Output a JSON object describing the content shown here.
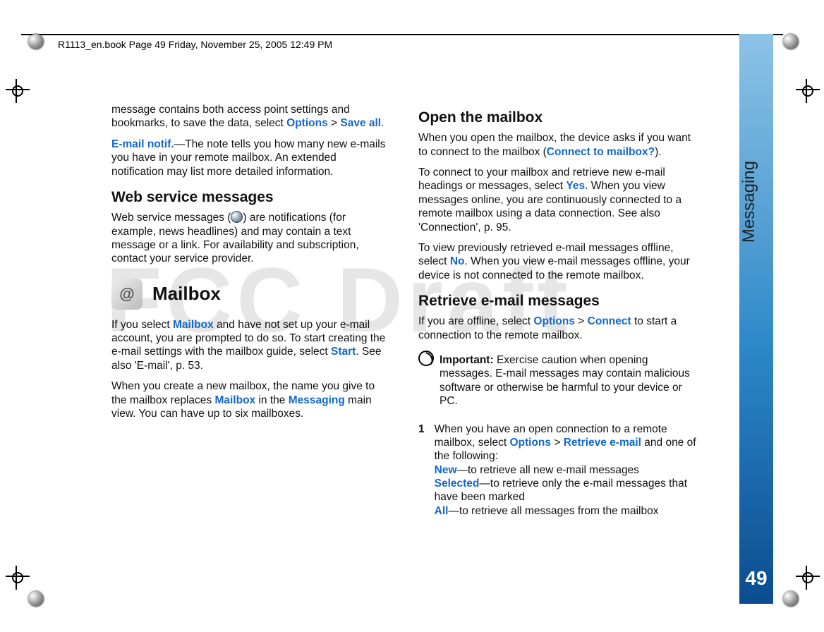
{
  "header": "R1113_en.book  Page 49  Friday, November 25, 2005  12:49 PM",
  "watermark": "FCC Draft",
  "sidebar": {
    "label": "Messaging",
    "page": "49"
  },
  "left": {
    "p1a": "message contains both access point settings and bookmarks, to save the data, select ",
    "kwOptions": "Options",
    "gt": " > ",
    "kwSaveAll": "Save all",
    "p1b": ".",
    "p2kw": "E-mail notif.",
    "p2": "—The note tells you how many new e-mails you have in your remote mailbox. An extended notification may list more detailed information.",
    "h3web": "Web service messages",
    "p3a": "Web service messages (",
    "p3b": ") are notifications (for example, news headlines) and may contain a text message or a link. For availability and subscription, contact your service provider.",
    "h2mailbox": "Mailbox",
    "p4a": "If you select ",
    "kwMailbox": "Mailbox",
    "p4b": " and have not set up your e-mail account, you are prompted to do so. To start creating the e-mail settings with the mailbox guide, select ",
    "kwStart": "Start",
    "p4c": ". See also 'E-mail', p. 53.",
    "p5a": "When you create a new mailbox, the name you give to the mailbox replaces ",
    "p5b": " in the ",
    "kwMessaging": "Messaging",
    "p5c": " main view. You can have up to six mailboxes."
  },
  "right": {
    "h3open": "Open the mailbox",
    "p1a": "When you open the mailbox, the device asks if you want to connect to the mailbox (",
    "kwConnectQ": "Connect to mailbox?",
    "p1b": ").",
    "p2a": "To connect to your mailbox and retrieve new e-mail headings or messages, select ",
    "kwYes": "Yes",
    "p2b": ". When you view messages online, you are continuously connected to a remote mailbox using a data connection. See also 'Connection', p. 95.",
    "p3a": "To view previously retrieved e-mail messages offline, select ",
    "kwNo": "No",
    "p3b": ". When you view e-mail messages offline, your device is not connected to the remote mailbox.",
    "h3retrieve": "Retrieve e-mail messages",
    "p4a": "If you are offline, select ",
    "kwOptions": "Options",
    "gt": " > ",
    "kwConnect": "Connect",
    "p4b": " to start a connection to the remote mailbox.",
    "importantLabel": "Important:",
    "importantText": " Exercise caution when opening messages. E-mail messages may contain malicious software or otherwise be harmful to your device or PC.",
    "step1num": "1",
    "step1a": "When you have an open connection to a remote mailbox, select ",
    "kwRetrieve": "Retrieve e-mail",
    "step1b": " and one of the following:",
    "optNew": "New",
    "optNewText": "—to retrieve all new e-mail messages",
    "optSelected": "Selected",
    "optSelectedText": "—to retrieve only the e-mail messages that have been marked",
    "optAll": "All",
    "optAllText": "—to retrieve all messages from the mailbox"
  }
}
